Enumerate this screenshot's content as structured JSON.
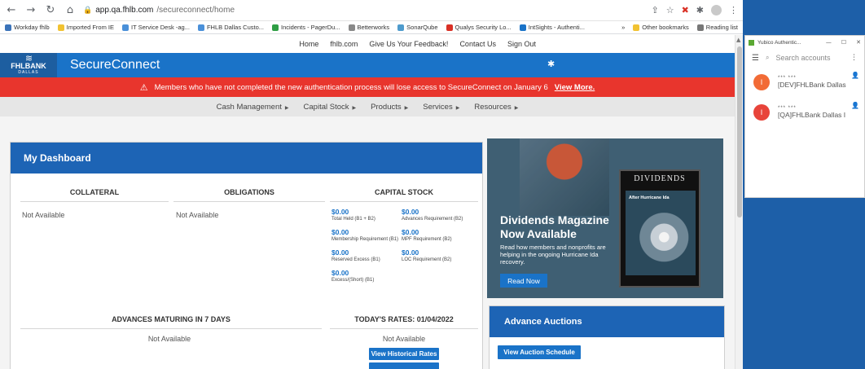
{
  "browser": {
    "url_host": "app.qa.fhlb.com",
    "url_path": "/secureconnect/home",
    "bookmarks": [
      {
        "label": "Workday fhlb",
        "color": "#3b73b9"
      },
      {
        "label": "Imported From IE",
        "color": "#f1c232"
      },
      {
        "label": "IT Service Desk -ag...",
        "color": "#4a90d9"
      },
      {
        "label": "FHLB Dallas Custo...",
        "color": "#4a90d9"
      },
      {
        "label": "Incidents - PagerDu...",
        "color": "#2e9e44"
      },
      {
        "label": "Betterworks",
        "color": "#888888"
      },
      {
        "label": "SonarQube",
        "color": "#4e9bcd"
      },
      {
        "label": "Qualys Security Lo...",
        "color": "#d93025"
      },
      {
        "label": "IntSights - Authenti...",
        "color": "#1a73c8"
      }
    ],
    "bookmarks_more": "»",
    "other_bookmarks": "Other bookmarks",
    "reading_list": "Reading list"
  },
  "topnav": [
    "Home",
    "fhlb.com",
    "Give Us Your Feedback!",
    "Contact Us",
    "Sign Out"
  ],
  "header": {
    "logo_line1": "FHLBANK",
    "logo_line2": "DALLAS",
    "brand": "SecureConnect"
  },
  "alert": {
    "message": "Members who have not completed the new authentication process will lose access to SecureConnect on January 6",
    "link": "View More."
  },
  "menu": [
    "Cash Management",
    "Capital Stock",
    "Products",
    "Services",
    "Resources"
  ],
  "dashboard": {
    "title": "My Dashboard",
    "collateral_title": "COLLATERAL",
    "collateral_value": "Not Available",
    "obligations_title": "OBLIGATIONS",
    "obligations_value": "Not Available",
    "capital_title": "CAPITAL STOCK",
    "capital": [
      {
        "value": "$0.00",
        "label": "Total Held (B1 + B2)"
      },
      {
        "value": "$0.00",
        "label": "Advances Requirement (B2)"
      },
      {
        "value": "$0.00",
        "label": "Membership Requirement (B1)"
      },
      {
        "value": "$0.00",
        "label": "MPF Requirement (B2)"
      },
      {
        "value": "$0.00",
        "label": "Reserved Excess (B1)"
      },
      {
        "value": "$0.00",
        "label": "LOC Requirement (B2)"
      },
      {
        "value": "$0.00",
        "label": "Excess/(Short) (B1)"
      }
    ],
    "advances_title": "ADVANCES MATURING IN 7 DAYS",
    "advances_value": "Not Available",
    "rates_title": "TODAY'S RATES: 01/04/2022",
    "rates_value": "Not Available",
    "historical_button": "View Historical Rates"
  },
  "magazine": {
    "cover_title": "DIVIDENDS",
    "cover_headline": "After Hurricane Ida",
    "title_line1": "Dividends Magazine",
    "title_line2": "Now Available",
    "body": "Read how members and nonprofits are helping in the ongoing Hurricane Ida recovery.",
    "button": "Read Now"
  },
  "auctions": {
    "title": "Advance Auctions",
    "button": "View Auction Schedule"
  },
  "authenticator": {
    "window_title": "Yubico Authentic...",
    "search_placeholder": "Search accounts",
    "accounts": [
      {
        "initial": "I",
        "masked": "*** ***",
        "name": "[DEV]FHLBank Dallas",
        "color": "#f26b36"
      },
      {
        "initial": "I",
        "masked": "*** ***",
        "name": "[QA]FHLBank Dallas I",
        "color": "#e8443a"
      }
    ]
  }
}
